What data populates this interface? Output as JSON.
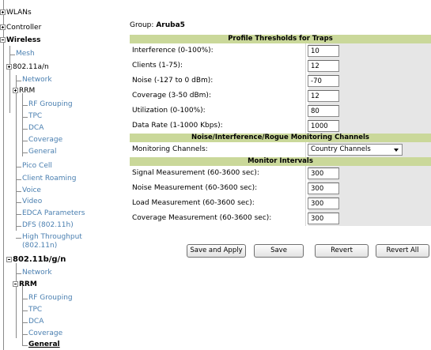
{
  "tree": {
    "wlans": "WLANs",
    "controller": "Controller",
    "wireless": "Wireless",
    "mesh": "Mesh",
    "radio_a": "802.11a/n",
    "network_a": "Network",
    "rrm_a": "RRM",
    "rf_grouping_a": "RF Grouping",
    "tpc_a": "TPC",
    "dca_a": "DCA",
    "coverage_a": "Coverage",
    "general_a": "General",
    "pico_cell": "Pico Cell",
    "client_roaming": "Client Roaming",
    "voice": "Voice",
    "video": "Video",
    "edca": "EDCA Parameters",
    "dfs": "DFS (802.11h)",
    "ht_line1": "High Throughput",
    "ht_line2": "(802.11n)",
    "radio_bg": "802.11b/g/n",
    "network_bg": "Network",
    "rrm_bg": "RRM",
    "rf_grouping_bg": "RF Grouping",
    "tpc_bg": "TPC",
    "dca_bg": "DCA",
    "coverage_bg": "Coverage",
    "general_bg": "General"
  },
  "group": {
    "label": "Group:",
    "name": "Aruba5"
  },
  "sections": {
    "thresholds": "Profile Thresholds for Traps",
    "channels": "Noise/Interference/Rogue Monitoring Channels",
    "intervals": "Monitor Intervals"
  },
  "thresholds": [
    {
      "label": "Interference (0-100%):",
      "value": "10"
    },
    {
      "label": "Clients (1-75):",
      "value": "12"
    },
    {
      "label": "Noise (-127 to 0 dBm):",
      "value": "-70"
    },
    {
      "label": "Coverage (3-50 dBm):",
      "value": "12"
    },
    {
      "label": "Utilization (0-100%):",
      "value": "80"
    },
    {
      "label": "Data Rate (1-1000 Kbps):",
      "value": "1000"
    }
  ],
  "channels": {
    "label": "Monitoring Channels:",
    "value": "Country Channels"
  },
  "intervals": [
    {
      "label": "Signal Measurement (60-3600 sec):",
      "value": "300"
    },
    {
      "label": "Noise Measurement (60-3600 sec):",
      "value": "300"
    },
    {
      "label": "Load Measurement (60-3600 sec):",
      "value": "300"
    },
    {
      "label": "Coverage Measurement (60-3600 sec):",
      "value": "300"
    }
  ],
  "buttons": {
    "save_apply": "Save and Apply",
    "save": "Save",
    "revert": "Revert",
    "revert_all": "Revert All"
  },
  "colors": {
    "section_header": "#cad89a",
    "tree_link": "#4a7fb0"
  }
}
